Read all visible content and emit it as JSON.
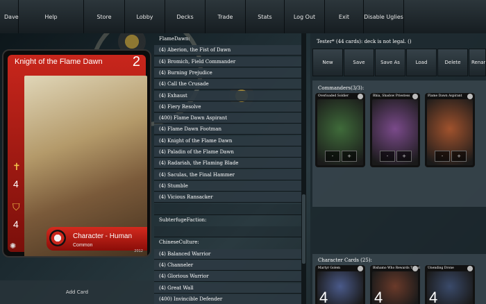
{
  "nav": [
    "Dave",
    "Help",
    "Store",
    "Lobby",
    "Decks",
    "Trade",
    "Stats",
    "Log Out",
    "Exit",
    "Disable Uglies"
  ],
  "card": {
    "name": "Knight of the Flame Dawn",
    "cost": "2",
    "attack": "4",
    "defense": "4",
    "type": "Character - Human",
    "rarity": "Common",
    "year": "2012"
  },
  "add_card": "Add Card",
  "card_list": [
    {
      "text": "FlameDawn:",
      "kind": "header"
    },
    {
      "text": "(4) Aberion, the Fist of Dawn",
      "kind": "item"
    },
    {
      "text": "(4) Bromich, Field Commander",
      "kind": "item"
    },
    {
      "text": "(4) Burning Prejudice",
      "kind": "item"
    },
    {
      "text": "(4) Call the Crusade",
      "kind": "item"
    },
    {
      "text": "(4) Exhaust",
      "kind": "item"
    },
    {
      "text": "(4) Fiery Resolve",
      "kind": "item"
    },
    {
      "text": "(400) Flame Dawn Aspirant",
      "kind": "item"
    },
    {
      "text": "(4) Flame Dawn Footman",
      "kind": "item"
    },
    {
      "text": "(4) Knight of the Flame Dawn",
      "kind": "item"
    },
    {
      "text": "(4) Paladin of the Flame Dawn",
      "kind": "item"
    },
    {
      "text": "(4) Radariah, the Flaming Blade",
      "kind": "item"
    },
    {
      "text": "(4) Saculas, the Final Hammer",
      "kind": "item"
    },
    {
      "text": "(4) Stumble",
      "kind": "item"
    },
    {
      "text": "(4) Vicious Ransacker",
      "kind": "item"
    },
    {
      "text": "",
      "kind": "blank"
    },
    {
      "text": "SubterfugeFaction:",
      "kind": "header"
    },
    {
      "text": "",
      "kind": "blank"
    },
    {
      "text": "ChineseCulture:",
      "kind": "header"
    },
    {
      "text": "(4) Balanced Warrior",
      "kind": "item"
    },
    {
      "text": "(4) Channeler",
      "kind": "item"
    },
    {
      "text": "(4) Glorious Warrior",
      "kind": "item"
    },
    {
      "text": "(4) Great Wall",
      "kind": "item"
    },
    {
      "text": "(400) Invincible Defender",
      "kind": "item"
    }
  ],
  "deck": {
    "title": "Tester* (44 cards): deck is not legal. ()",
    "buttons": [
      "New",
      "Save",
      "Save As",
      "Load",
      "Delete",
      "Renam"
    ],
    "commanders_title": "Commanders(3/3):",
    "commanders": [
      {
        "name": "Overloaded Soldier",
        "art": "#3f6b3a"
      },
      {
        "name": "Rhia, Shadow Priestess",
        "art": "#7a4a8a"
      },
      {
        "name": "Flame Dawn Aspirant",
        "art": "#a0522d"
      }
    ],
    "characters_title": "Character Cards (25):",
    "characters": [
      {
        "name": "Martyr Golem",
        "count": "4",
        "art": "#4a5a8a"
      },
      {
        "name": "Bishamo Who Rewards Tribute",
        "count": "4",
        "art": "#6a3a2a"
      },
      {
        "name": "Unending Drone",
        "count": "4",
        "art": "#3a4a6a"
      }
    ]
  },
  "controls": {
    "minus": "-",
    "plus": "+"
  }
}
